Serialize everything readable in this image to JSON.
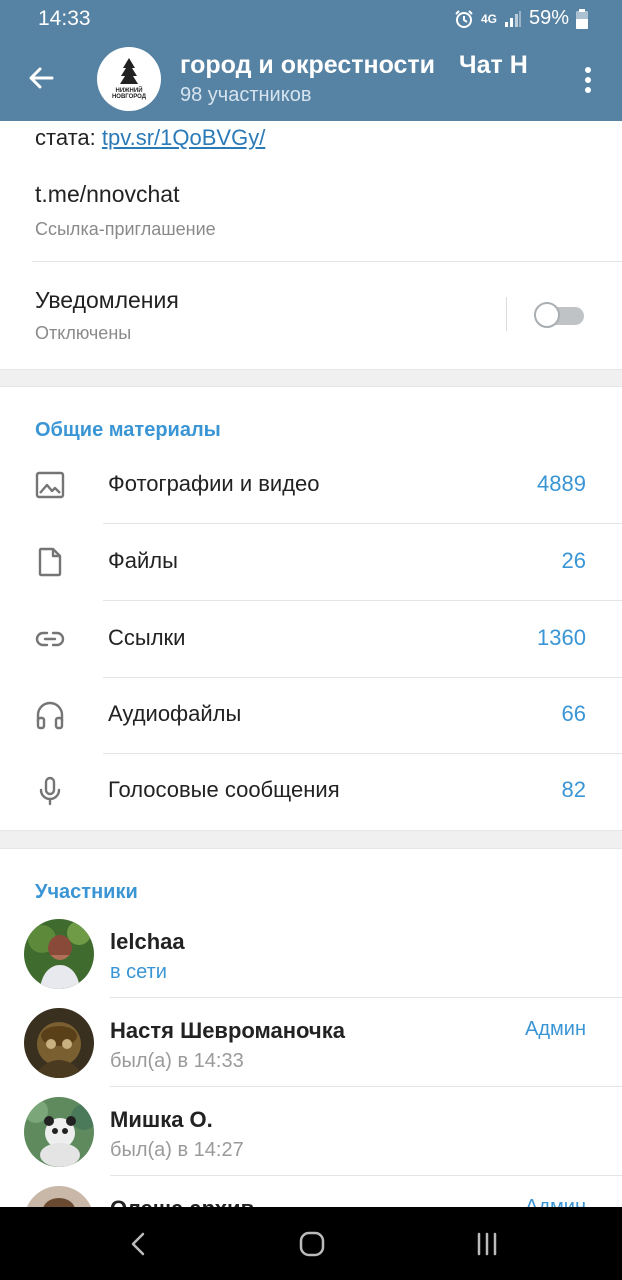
{
  "status_bar": {
    "time": "14:33",
    "network": "4G",
    "battery": "59%"
  },
  "header": {
    "title_segments": [
      "город и окрестности",
      "Чат Н"
    ],
    "subtitle": "98 участников",
    "accent_color": "#5682a3",
    "group_avatar_text": [
      "НИЖНИЙ",
      "НОВГОРОД"
    ]
  },
  "info": {
    "description_prefix": "стата:",
    "description_link": "tpv.sr/1QoBVGy/",
    "invite_link": "t.me/nnovchat",
    "invite_caption": "Ссылка-приглашение",
    "notifications_label": "Уведомления",
    "notifications_status": "Отключены",
    "notifications_enabled": false
  },
  "shared_media": {
    "title": "Общие материалы",
    "items": [
      {
        "icon": "photo-icon",
        "label": "Фотографии и видео",
        "count": "4889"
      },
      {
        "icon": "file-icon",
        "label": "Файлы",
        "count": "26"
      },
      {
        "icon": "link-icon",
        "label": "Ссылки",
        "count": "1360"
      },
      {
        "icon": "headphones-icon",
        "label": "Аудиофайлы",
        "count": "66"
      },
      {
        "icon": "microphone-icon",
        "label": "Голосовые сообщения",
        "count": "82"
      }
    ]
  },
  "members": {
    "title": "Участники",
    "items": [
      {
        "name": "lelchaa",
        "status": "в сети",
        "role": ""
      },
      {
        "name": "Настя Шевроманочка",
        "status": "был(а) в 14:33",
        "role": "Админ"
      },
      {
        "name": "Мишка О.",
        "status": "был(а) в 14:27",
        "role": ""
      },
      {
        "name": "Олеша архив",
        "status": "",
        "role": "Админ"
      }
    ]
  },
  "colors": {
    "link": "#3a95d5",
    "secondary_text": "#8a8a8a"
  }
}
